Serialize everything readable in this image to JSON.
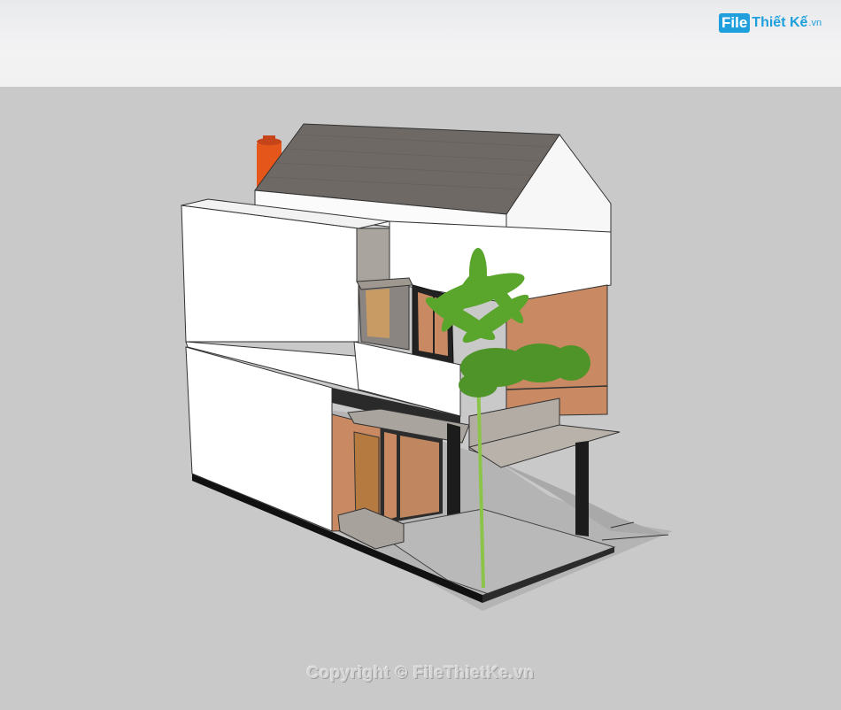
{
  "logo": {
    "brand_box": "File",
    "brand_name": "Thiết Kế",
    "brand_tld": ".vn"
  },
  "watermark": {
    "text": "Copyright © FileThietKe.vn"
  },
  "colors": {
    "sky": "#eeeeef",
    "ground": "#c9c9c9",
    "roof": "#6f6a66",
    "wall": "#ffffff",
    "brick": "#c98a63",
    "chimney": "#e5561a",
    "steel": "#1c1c1c",
    "logo_blue": "#1f9fdc"
  }
}
